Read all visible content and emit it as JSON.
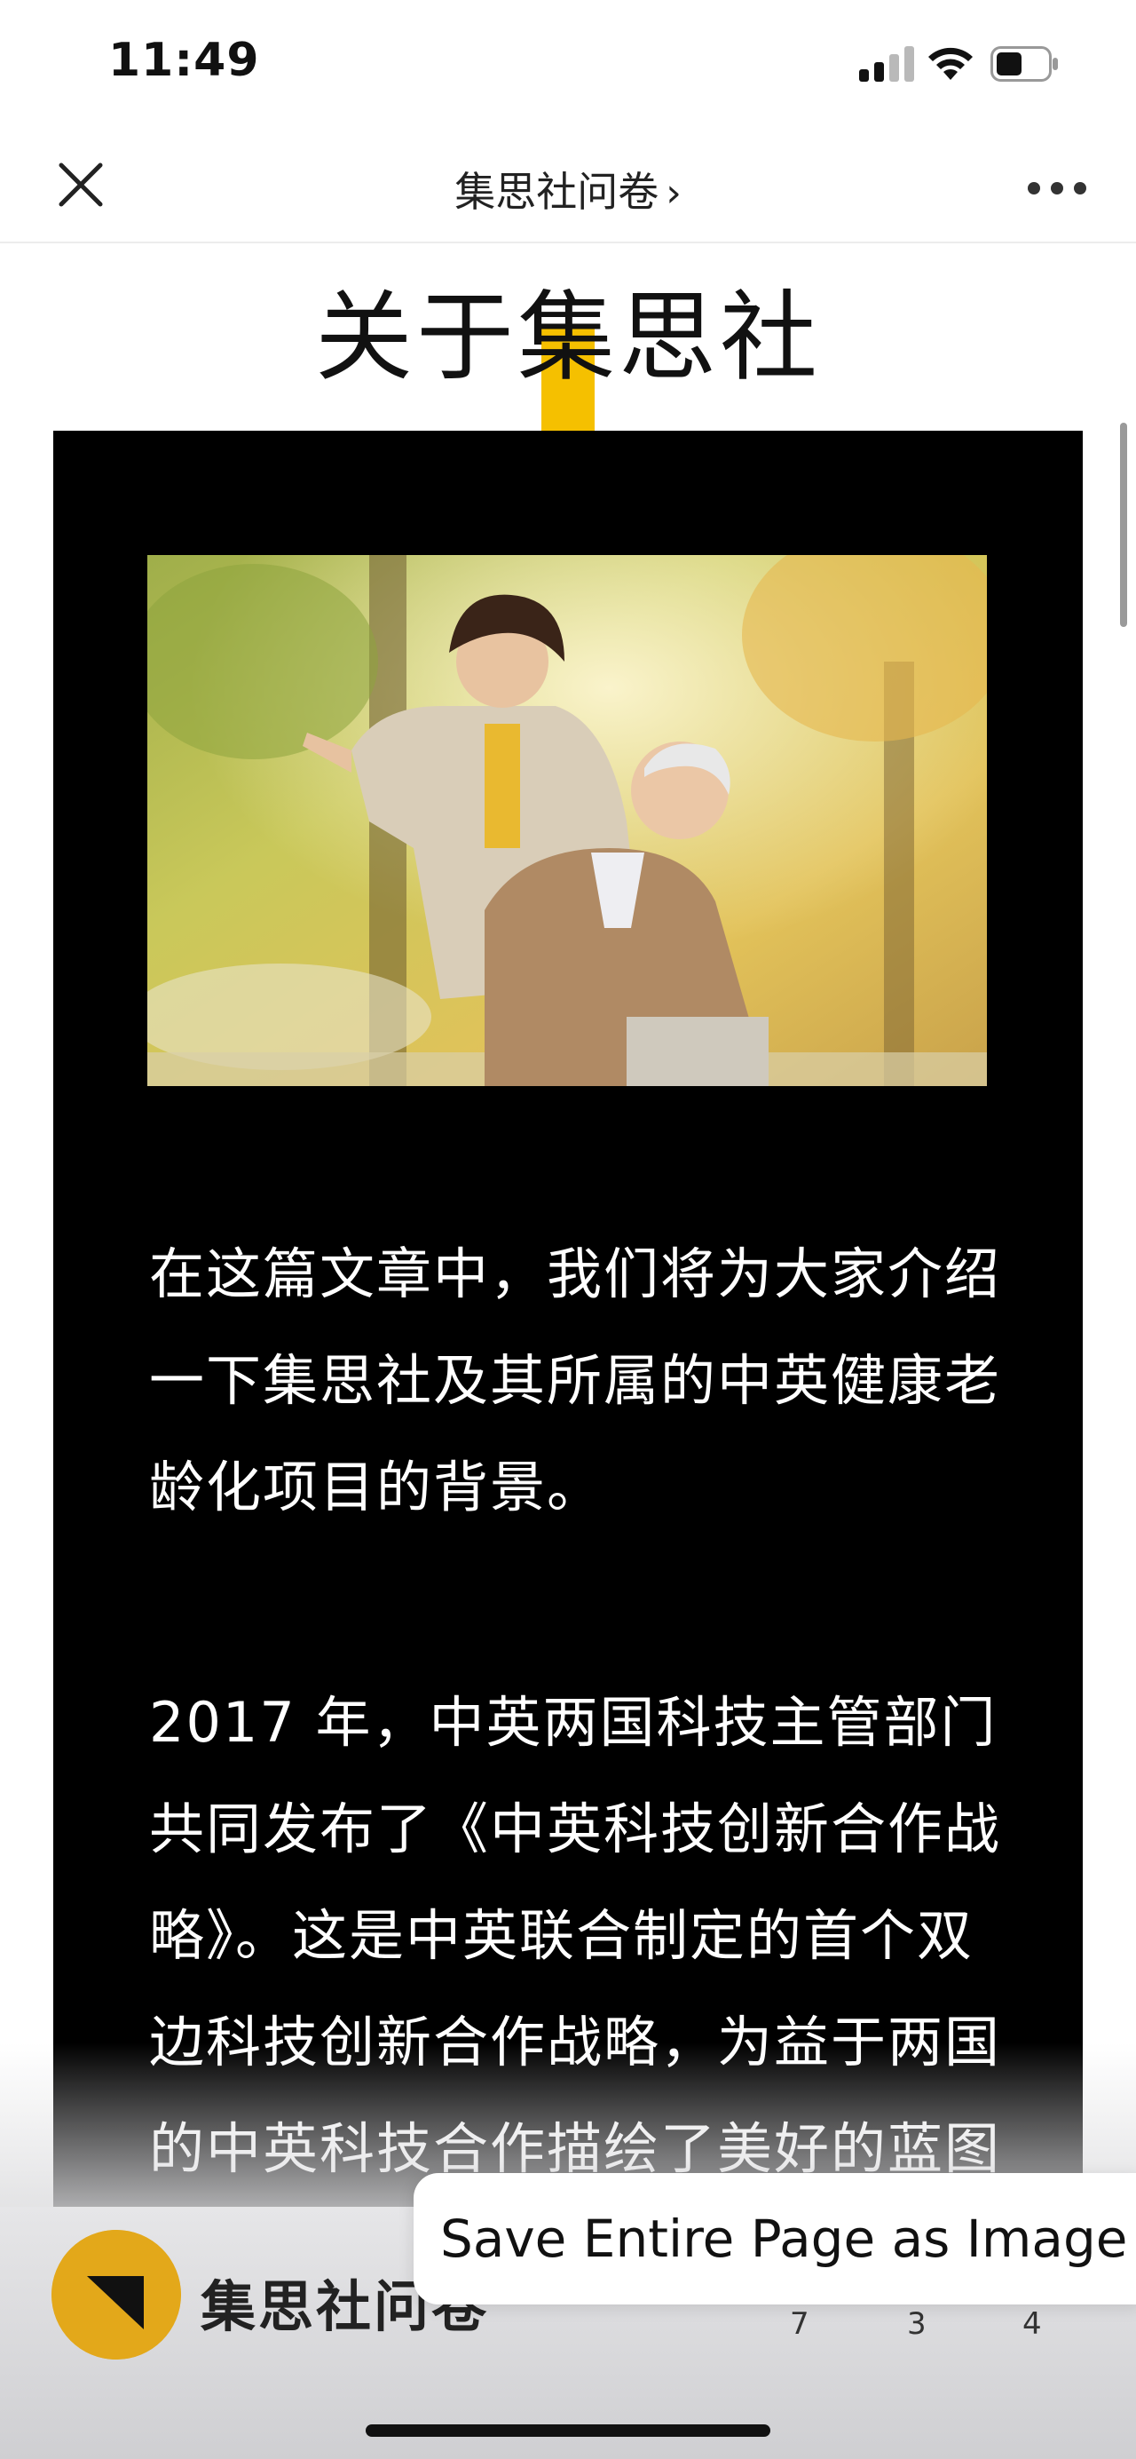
{
  "status_bar": {
    "time": "11:49",
    "signal_icon": "cellular-signal-icon",
    "wifi_icon": "wifi-icon",
    "battery_icon": "battery-icon",
    "battery_level": 0.45
  },
  "nav": {
    "close_icon": "close-icon",
    "title": "集思社问卷",
    "title_chevron": "›",
    "more_icon": "more-horizontal-icon"
  },
  "article": {
    "heading": "关于集思社",
    "accent_color": "#f5c000",
    "photo_alt_icon": "photo-elderly-couple",
    "paragraph_1": "在这篇文章中，我们将为大家介绍一下集思社及其所属的中英健康老龄化项目的背景。",
    "paragraph_2": "2017 年，中英两国科技主管部门共同发布了《中英科技创新合作战略》。这是中英联合制定的首个双边科技创新合作战略，为益于两国的中英科技合作描绘了美好的蓝图"
  },
  "bottom_bar": {
    "logo_icon": "jisishe-logo",
    "brand_name": "集思社问卷",
    "counts": [
      "7",
      "3",
      "4"
    ]
  },
  "save_prompt": {
    "label": "Save Entire Page as Image",
    "chevron": "›"
  }
}
